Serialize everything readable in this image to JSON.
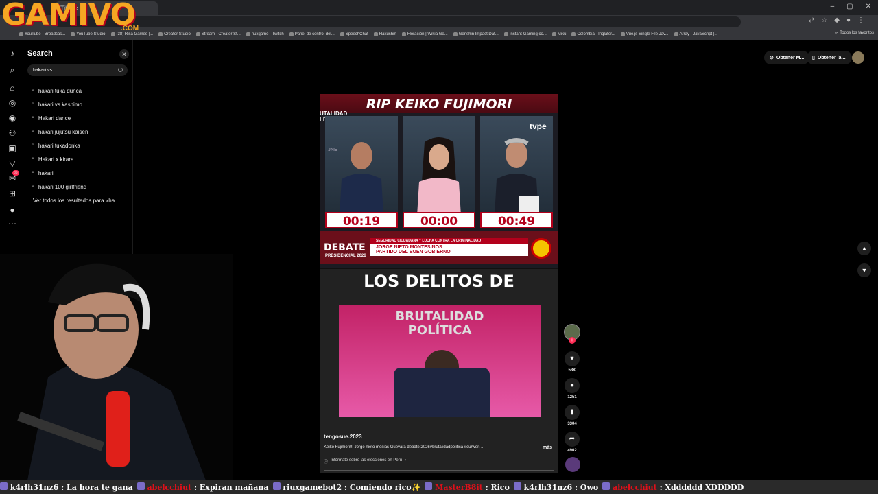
{
  "browser": {
    "tab_title": "TikTok",
    "window_controls": [
      "–",
      "▢",
      "✕"
    ],
    "toolbar_icons": [
      "translate-icon",
      "star-icon",
      "extension-icon",
      "profile-icon",
      "menu-icon"
    ],
    "bookmarks": [
      "YouTube - Broadcas...",
      "YouTube Studio",
      "(38) Risa Games |...",
      "Creator Studio",
      "Stream - Creator St...",
      "riuxgame - Twitch",
      "Panel de control del...",
      "SpeechChat",
      "Hakushin",
      "Floración | Wikia Ge...",
      "Genshin Impact Dat...",
      "Instant-Gaming.co...",
      "Miku",
      "Colombia - Inglater...",
      "Vue.js Single File Jav...",
      "Array - JavaScript |..."
    ],
    "bookmarks_overflow": "»",
    "all_bookmarks": "Todos los favoritos"
  },
  "watermark": {
    "logo": "GAMIVO",
    "logo_suffix": ".COM"
  },
  "search": {
    "title": "Search",
    "close": "✕",
    "value": "hakari vs",
    "suggestions": [
      "hakari tuka dunca",
      "hakari vs kashimo",
      "Hakari dance",
      "hakari jujutsu kaisen",
      "hakari tukadonka",
      "Hakari x kirara",
      "hakari",
      "hakari 100 girlfriend"
    ],
    "see_all": "Ver todos los resultados para «ha..."
  },
  "rail": {
    "inbox_badge": "35"
  },
  "top_right": {
    "button1": "Obtener M...",
    "button2": "Obtener la ..."
  },
  "video": {
    "headline": "RIP KEIKO FUJIMORI",
    "side_label": "UTALIDAD\nLÍTICA",
    "network": "tvpe",
    "jne": "JNE",
    "timers": [
      "00:19",
      "00:00",
      "00:49"
    ],
    "debate": "DEBATE",
    "debate_sub": "PRESIDENCIAL 2026",
    "topic": "SEGURIDAD CIUDADANA Y LUCHA CONTRA LA CRIMINALIDAD",
    "candidate": "JORGE NIETO MONTESINOS",
    "party": "PARTIDO DEL BUEN GOBIERNO",
    "lower_title": "LOS DELITOS DE",
    "set_title": "BRUTALIDAD\nPOLÍTICA",
    "username": "tengosue.2023",
    "description": "Keiko Fujimori!!! Jorge nieto mesias Guevara debate 2026#brutalidadpolitica #curwen ...",
    "more": "más",
    "info": "Infórmate sobre las elecciones en Perú",
    "progress": 0.0
  },
  "actions": {
    "likes": "58K",
    "comments": "1251",
    "saves": "3304",
    "shares": "4902"
  },
  "ticker": [
    {
      "user": "k4rlh31nz6",
      "msg": "La hora te gana",
      "red": false
    },
    {
      "user": "abelcchiut",
      "msg": "Expiran mañana",
      "red": true
    },
    {
      "user": "riuxgamebot2",
      "msg": "Comiendo rico✨",
      "red": false
    },
    {
      "user": "MasterB8it",
      "msg": "Rico",
      "red": true
    },
    {
      "user": "k4rlh31nz6",
      "msg": "Owo",
      "red": false
    },
    {
      "user": "abelcchiut",
      "msg": "Xdddddd XDDDDD",
      "red": true
    }
  ]
}
